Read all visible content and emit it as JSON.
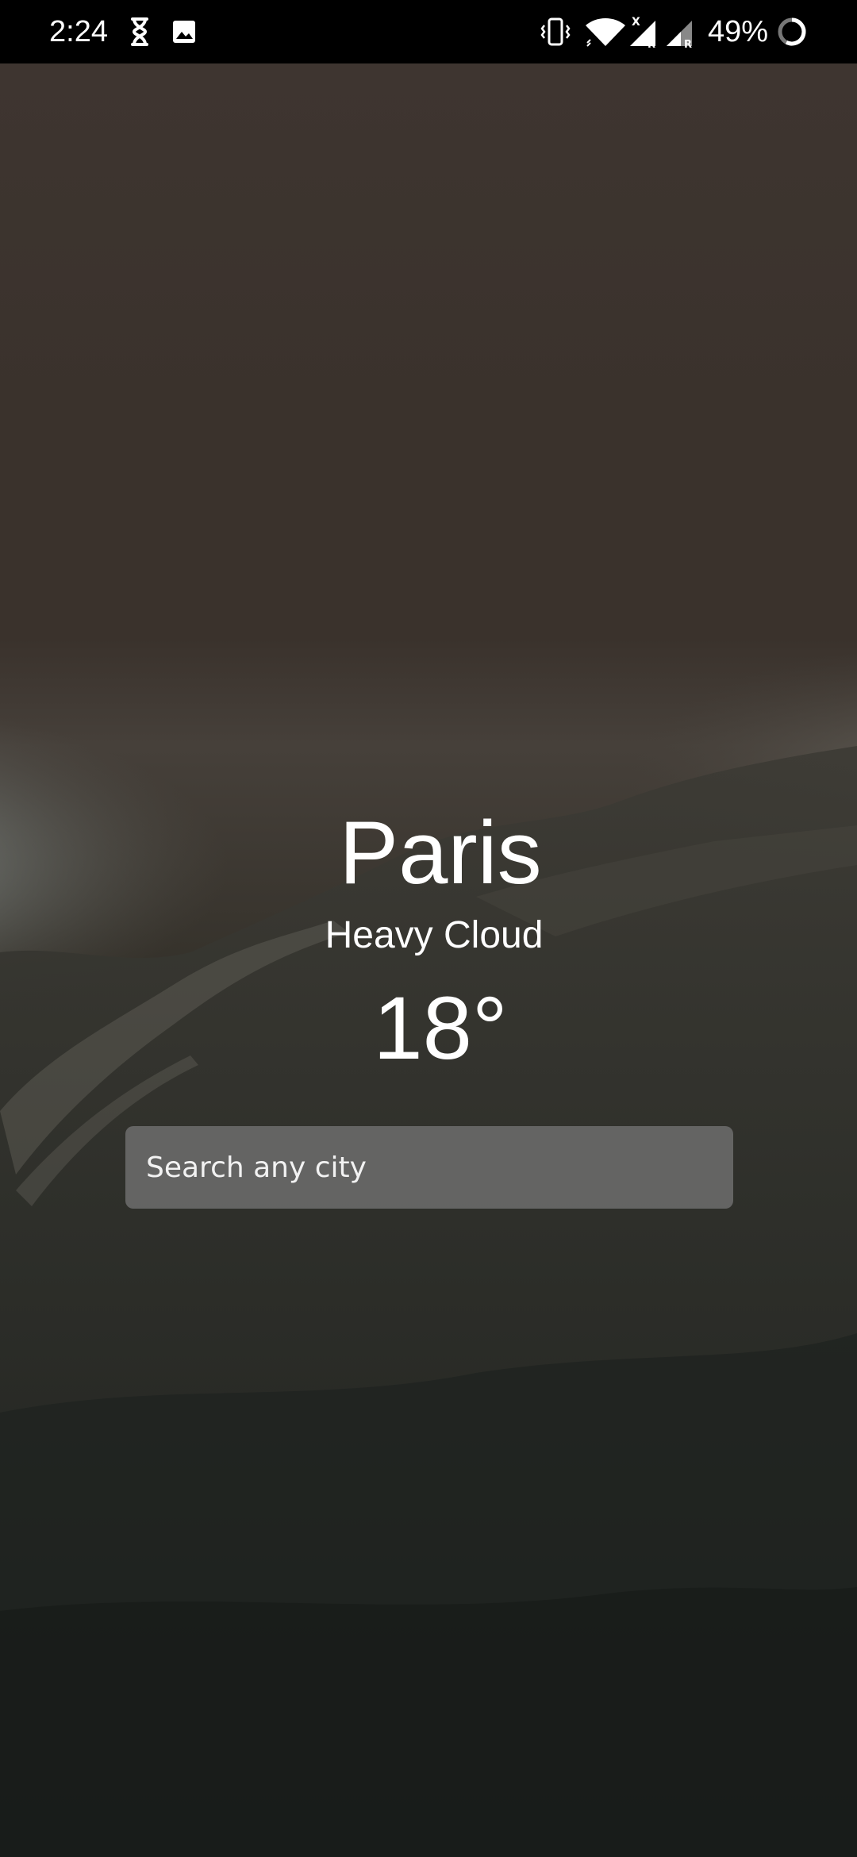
{
  "status_bar": {
    "time": "2:24",
    "battery_percent": "49%",
    "icons": [
      "hourglass-icon",
      "image-icon",
      "vibrate-icon",
      "wifi-icon",
      "signal-x-icon",
      "signal-r-icon",
      "signal-r-icon",
      "battery-ring-icon"
    ]
  },
  "weather": {
    "city": "Paris",
    "condition": "Heavy Cloud",
    "temperature": "18°"
  },
  "search": {
    "placeholder": "Search any city",
    "value": ""
  },
  "colors": {
    "status_bar_bg": "#000000",
    "text": "#ffffff",
    "search_bg": "#666666"
  }
}
